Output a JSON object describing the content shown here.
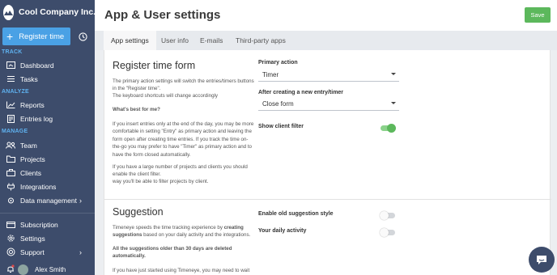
{
  "sidebar": {
    "company": "Cool Company Inc.",
    "register_label": "Register time",
    "sections": {
      "track": "TRACK",
      "analyze": "ANALYZE",
      "manage": "MANAGE"
    },
    "items": {
      "dashboard": "Dashboard",
      "tasks": "Tasks",
      "reports": "Reports",
      "entries_log": "Entries log",
      "team": "Team",
      "projects": "Projects",
      "clients": "Clients",
      "integrations": "Integrations",
      "data_management": "Data management",
      "subscription": "Subscription",
      "settings": "Settings",
      "support": "Support"
    },
    "user_name": "Alex Smith"
  },
  "header": {
    "title": "App & User settings",
    "save_label": "Save"
  },
  "tabs": [
    "App settings",
    "User info",
    "E-mails",
    "Third-party apps"
  ],
  "register": {
    "title": "Register time form",
    "para1": "The primary action settings will switch the entries/timers buttons in the \"Register time\".",
    "para2": "The keyboard shortcuts will change accordingly",
    "best_heading": "What's best for me?",
    "para3": "If you insert entries only at the end of the day, you may be more comfortable in setting \"Entry\" as primary action and leaving the form open after creating time entries. If you track the time on-the-go you may prefer to have \"Timer\" as primary action and to have the form closed automatically.",
    "para4": "If you have a large number of projects and clients you should enable the client filter.",
    "para5": "way you'll be able to filter projects by client.",
    "primary_action_label": "Primary action",
    "primary_action_value": "Timer",
    "after_create_label": "After creating a new entry/timer",
    "after_create_value": "Close form",
    "client_filter_label": "Show client filter",
    "client_filter_on": true
  },
  "suggestion": {
    "title": "Suggestion",
    "para1_a": "Timeneye speeds the time tracking experience by ",
    "para1_b": "creating suggestions",
    "para1_c": " based on your daily activity and the integrations.",
    "para2": "All the suggestions older than 30 days are deleted automatically.",
    "para3": "If you have just started using Timeneye, you may need to wait",
    "old_style_label": "Enable old suggestion style",
    "old_style_on": false,
    "daily_activity_label": "Your daily activity",
    "daily_activity_on": false
  },
  "colors": {
    "sidebar": "#3d4c6b",
    "accent_blue": "#4aa1e5",
    "section_blue": "#5fb2f0",
    "save_green": "#5cb85c"
  }
}
